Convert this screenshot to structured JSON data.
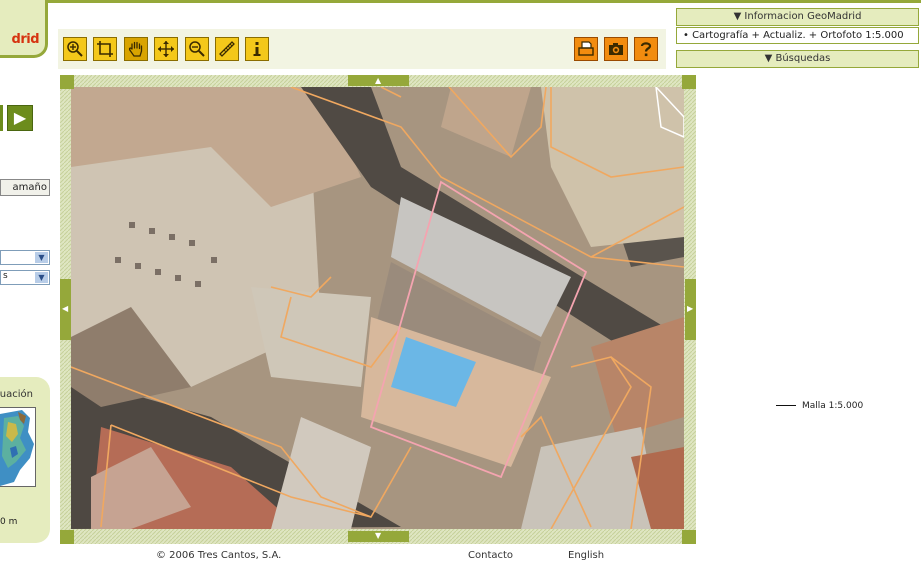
{
  "logo": {
    "text": "drid"
  },
  "sidebar": {
    "nav_arrow": "▶",
    "size_button_label": "amaño",
    "select1_value": "",
    "select2_value": "s",
    "situation_title": "uación",
    "scale_label": "0 m"
  },
  "toolbar": {
    "tools": [
      "zoom-in",
      "zoom-box",
      "pan",
      "center",
      "zoom-out",
      "measure",
      "info"
    ],
    "right_tools": [
      "print",
      "screenshot",
      "help"
    ],
    "active": "pan"
  },
  "right_panel": {
    "info_header": "▼ Informacion GeoMadrid",
    "info_item": "• Cartografía + Actualiz. + Ortofoto 1:5.000",
    "search_header": "▼ Búsquedas",
    "legend_label": "Malla 1:5.000"
  },
  "footer": {
    "copyright": "© 2006 Tres Cantos, S.A.",
    "contact": "Contacto",
    "english": "English"
  },
  "colors": {
    "accent": "#95a83a",
    "tool_yellow": "#f4c81a",
    "tool_orange": "#f28c0f",
    "logo_red": "#d63310"
  }
}
